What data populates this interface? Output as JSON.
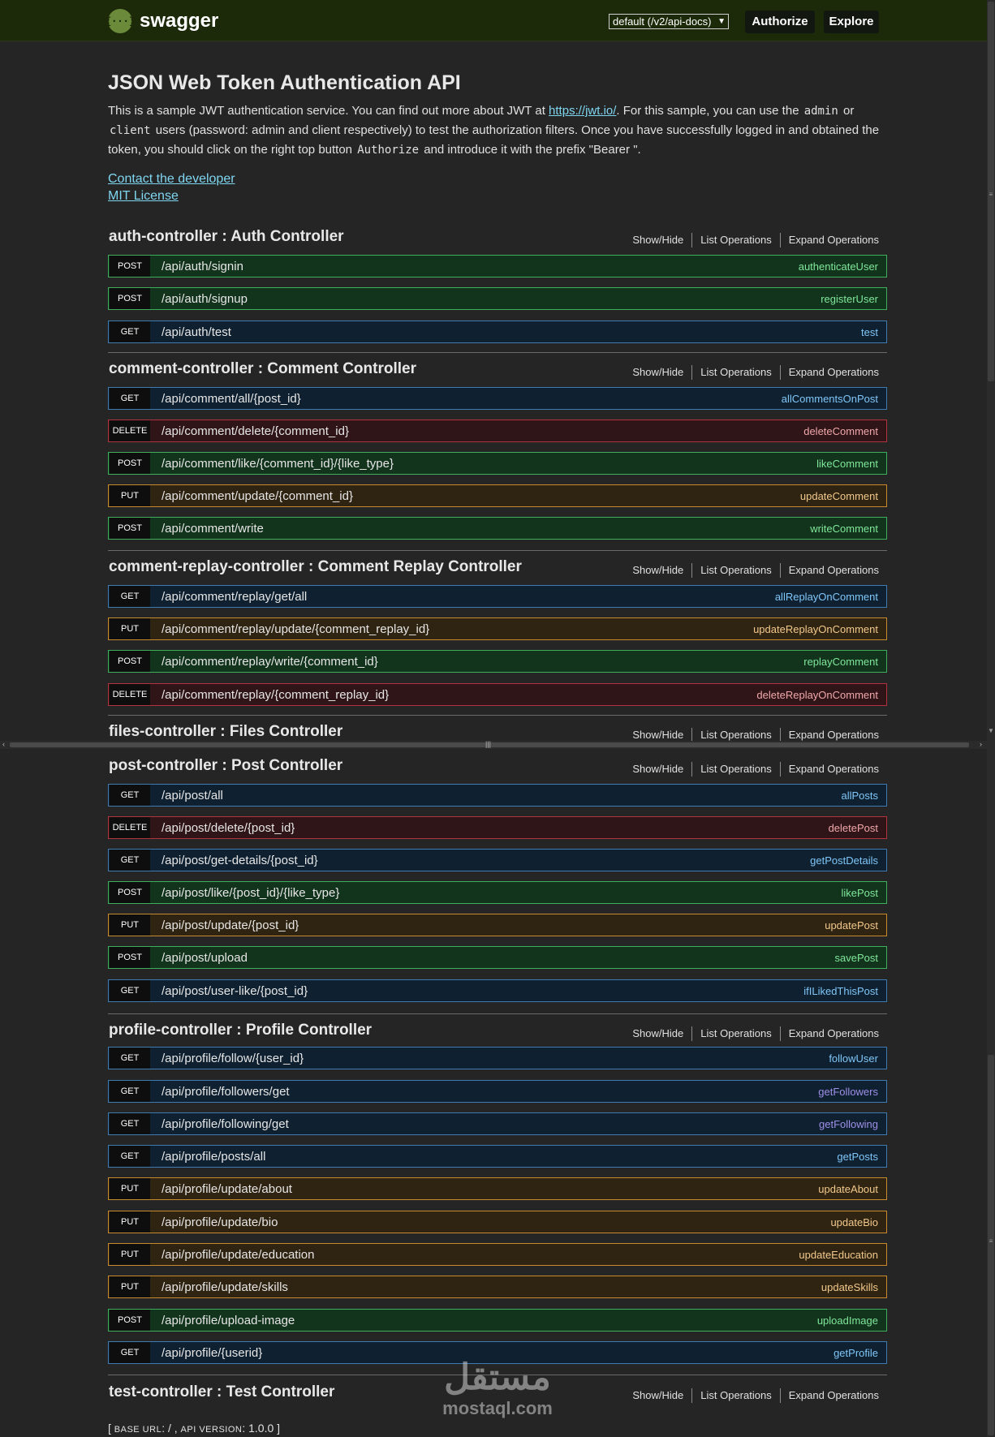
{
  "header": {
    "logo_icon": "{···}",
    "logo_text": "swagger",
    "spec_select": "default (/v2/api-docs)",
    "authorize_label": "Authorize",
    "explore_label": "Explore"
  },
  "info": {
    "title": "JSON Web Token Authentication API",
    "desc_1": "This is a sample JWT authentication service. You can find out more about JWT at ",
    "desc_link": "https://jwt.io/",
    "desc_2": ". For this sample, you can use the ",
    "code_admin": "admin",
    "desc_3": " or ",
    "code_client": "client",
    "desc_4": " users (password: admin and client respectively) to test the authorization filters. Once you have successfully logged in and obtained the token, you should click on the right top button ",
    "code_authorize": "Authorize",
    "desc_5": " and introduce it with the prefix \"Bearer \".",
    "contact": "Contact the developer",
    "license": "MIT License"
  },
  "links": {
    "show_hide": "Show/Hide",
    "list_ops": "List Operations",
    "expand_ops": "Expand Operations"
  },
  "controllers": [
    {
      "name": "auth-controller : Auth Controller",
      "ops": [
        {
          "method": "POST",
          "path": "/api/auth/signin",
          "nickname": "authenticateUser"
        },
        {
          "method": "POST",
          "path": "/api/auth/signup",
          "nickname": "registerUser"
        },
        {
          "method": "GET",
          "path": "/api/auth/test",
          "nickname": "test"
        }
      ]
    },
    {
      "name": "comment-controller : Comment Controller",
      "ops": [
        {
          "method": "GET",
          "path": "/api/comment/all/{post_id}",
          "nickname": "allCommentsOnPost"
        },
        {
          "method": "DELETE",
          "path": "/api/comment/delete/{comment_id}",
          "nickname": "deleteComment"
        },
        {
          "method": "POST",
          "path": "/api/comment/like/{comment_id}/{like_type}",
          "nickname": "likeComment"
        },
        {
          "method": "PUT",
          "path": "/api/comment/update/{comment_id}",
          "nickname": "updateComment"
        },
        {
          "method": "POST",
          "path": "/api/comment/write",
          "nickname": "writeComment"
        }
      ]
    },
    {
      "name": "comment-replay-controller : Comment Replay Controller",
      "ops": [
        {
          "method": "GET",
          "path": "/api/comment/replay/get/all",
          "nickname": "allReplayOnComment"
        },
        {
          "method": "PUT",
          "path": "/api/comment/replay/update/{comment_replay_id}",
          "nickname": "updateReplayOnComment"
        },
        {
          "method": "POST",
          "path": "/api/comment/replay/write/{comment_id}",
          "nickname": "replayComment"
        },
        {
          "method": "DELETE",
          "path": "/api/comment/replay/{comment_replay_id}",
          "nickname": "deleteReplayOnComment"
        }
      ]
    },
    {
      "name": "files-controller : Files Controller",
      "ops": []
    },
    {
      "name": "post-controller : Post Controller",
      "ops": [
        {
          "method": "GET",
          "path": "/api/post/all",
          "nickname": "allPosts"
        },
        {
          "method": "DELETE",
          "path": "/api/post/delete/{post_id}",
          "nickname": "deletePost"
        },
        {
          "method": "GET",
          "path": "/api/post/get-details/{post_id}",
          "nickname": "getPostDetails"
        },
        {
          "method": "POST",
          "path": "/api/post/like/{post_id}/{like_type}",
          "nickname": "likePost"
        },
        {
          "method": "PUT",
          "path": "/api/post/update/{post_id}",
          "nickname": "updatePost"
        },
        {
          "method": "POST",
          "path": "/api/post/upload",
          "nickname": "savePost"
        },
        {
          "method": "GET",
          "path": "/api/post/user-like/{post_id}",
          "nickname": "ifILikedThisPost"
        }
      ]
    },
    {
      "name": "profile-controller : Profile Controller",
      "ops": [
        {
          "method": "GET",
          "path": "/api/profile/follow/{user_id}",
          "nickname": "followUser"
        },
        {
          "method": "GET",
          "path": "/api/profile/followers/get",
          "nickname": "getFollowers",
          "nick_color": "violet"
        },
        {
          "method": "GET",
          "path": "/api/profile/following/get",
          "nickname": "getFollowing",
          "nick_color": "violet"
        },
        {
          "method": "GET",
          "path": "/api/profile/posts/all",
          "nickname": "getPosts"
        },
        {
          "method": "PUT",
          "path": "/api/profile/update/about",
          "nickname": "updateAbout"
        },
        {
          "method": "PUT",
          "path": "/api/profile/update/bio",
          "nickname": "updateBio"
        },
        {
          "method": "PUT",
          "path": "/api/profile/update/education",
          "nickname": "updateEducation"
        },
        {
          "method": "PUT",
          "path": "/api/profile/update/skills",
          "nickname": "updateSkills"
        },
        {
          "method": "POST",
          "path": "/api/profile/upload-image",
          "nickname": "uploadImage"
        },
        {
          "method": "GET",
          "path": "/api/profile/{userid}",
          "nickname": "getProfile"
        }
      ]
    },
    {
      "name": "test-controller : Test Controller",
      "ops": []
    }
  ],
  "footer": {
    "open": "[ ",
    "base_url_label": "BASE URL",
    "base_url_value": ": / , ",
    "api_version_label": "API VERSION",
    "api_version_value": ": 1.0.0 ]"
  },
  "watermark": {
    "arabic": "مستقل",
    "latin": "mostaql.com"
  }
}
